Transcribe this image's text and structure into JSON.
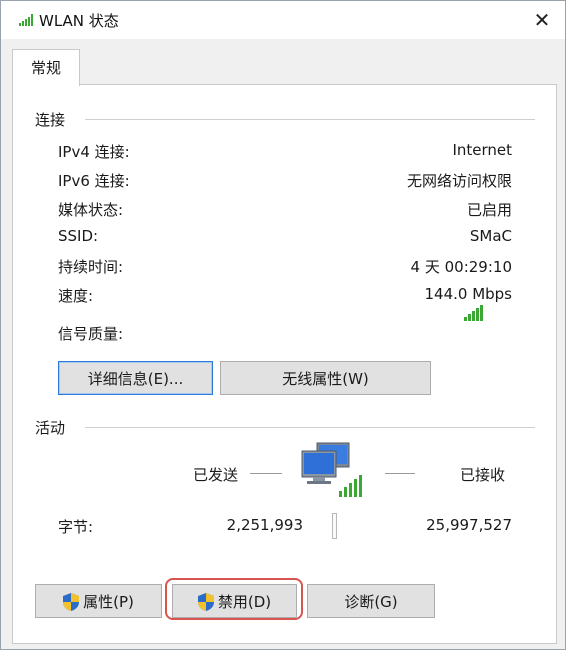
{
  "window": {
    "title": "WLAN 状态",
    "close": "✕"
  },
  "tabs": [
    {
      "label": "常规"
    }
  ],
  "connection": {
    "group_label": "连接",
    "rows": [
      {
        "label": "IPv4 连接:",
        "value": "Internet"
      },
      {
        "label": "IPv6 连接:",
        "value": "无网络访问权限"
      },
      {
        "label": "媒体状态:",
        "value": "已启用"
      },
      {
        "label": "SSID:",
        "value": "SMaC"
      },
      {
        "label": "持续时间:",
        "value": "4 天 00:29:10"
      },
      {
        "label": "速度:",
        "value": "144.0 Mbps"
      }
    ],
    "signal_label": "信号质量:",
    "signal_bars": 5,
    "details_button": "详细信息(E)...",
    "wireless_props_button": "无线属性(W)"
  },
  "activity": {
    "group_label": "活动",
    "sent_label": "已发送",
    "received_label": "已接收",
    "bytes_label": "字节:",
    "bytes_sent": "2,251,993",
    "bytes_received": "25,997,527"
  },
  "buttons": {
    "properties": "属性(P)",
    "disable": "禁用(D)",
    "diagnose": "诊断(G)"
  },
  "colors": {
    "signal_green": "#3aa832",
    "shield_blue": "#2a6cc7",
    "shield_yellow": "#f2c12e",
    "highlight_red": "#d9534f",
    "focus_blue": "#2b79d8"
  }
}
